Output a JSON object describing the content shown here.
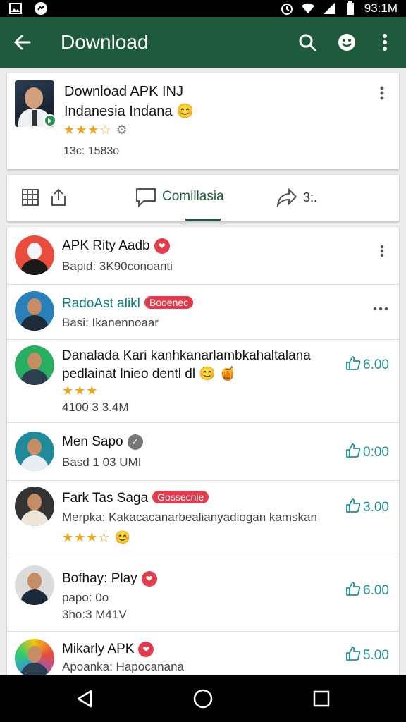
{
  "status_bar": {
    "time": "93:1M",
    "left_icons": [
      "gallery-icon",
      "messenger-icon"
    ],
    "right_icons": [
      "alarm-icon",
      "wifi-icon",
      "signal-icon",
      "battery-icon"
    ]
  },
  "app_bar": {
    "title": "Download",
    "background": "#1e5a3c",
    "actions": [
      "search-icon",
      "emoji-icon",
      "more-vert-icon"
    ]
  },
  "app_card": {
    "name_line1": "Download APK INЈ",
    "name_line2": "Indanesia  Indana 😊",
    "rating": "★★★☆",
    "meta": "13с: 1583о"
  },
  "tabs": {
    "active_label": "Comillasia",
    "share_count": "3:."
  },
  "list": [
    {
      "name": "APK Rity Aadb",
      "badge": "❤",
      "sub": "Bapid: 3K90conoanti",
      "accent": "#e94b3c"
    },
    {
      "name": "RadoAst alikl",
      "badge": "Booenec",
      "sub": "Basi: Ikanennoaar",
      "accent": "#2980b9"
    },
    {
      "name": "Danalada Kari kanhkanarlambkahaltalana",
      "name2": "pedlainat lnieo dentl dl 😊 🍯",
      "stars": "★★★",
      "meta": "4100 3 3.4M",
      "price": "6.00",
      "accent": "#27ae60"
    },
    {
      "name": "Men Sapo",
      "sub": "Basd 1 03 UMI",
      "price": "0:00",
      "accent": "#1f8a9a"
    },
    {
      "name": "Fark Tas Saga",
      "badge": "Gossecnie",
      "sub": "Merpka: Kakacacanarbealianyadiogan kamskan",
      "stars": "★★★☆ 😊",
      "price": "3.00",
      "accent": "#333333"
    },
    {
      "name": "Bofhay: Play",
      "badge": "❤",
      "sub": "papo: 0o",
      "meta": "3ho:3 M41V",
      "price": "6.00",
      "accent": "#dcdcdc"
    },
    {
      "name": "Mikarly APK",
      "badge": "❤",
      "sub": "Apoanka: Hapocanana",
      "price": "5.00",
      "accent": "#f1c40f"
    }
  ]
}
